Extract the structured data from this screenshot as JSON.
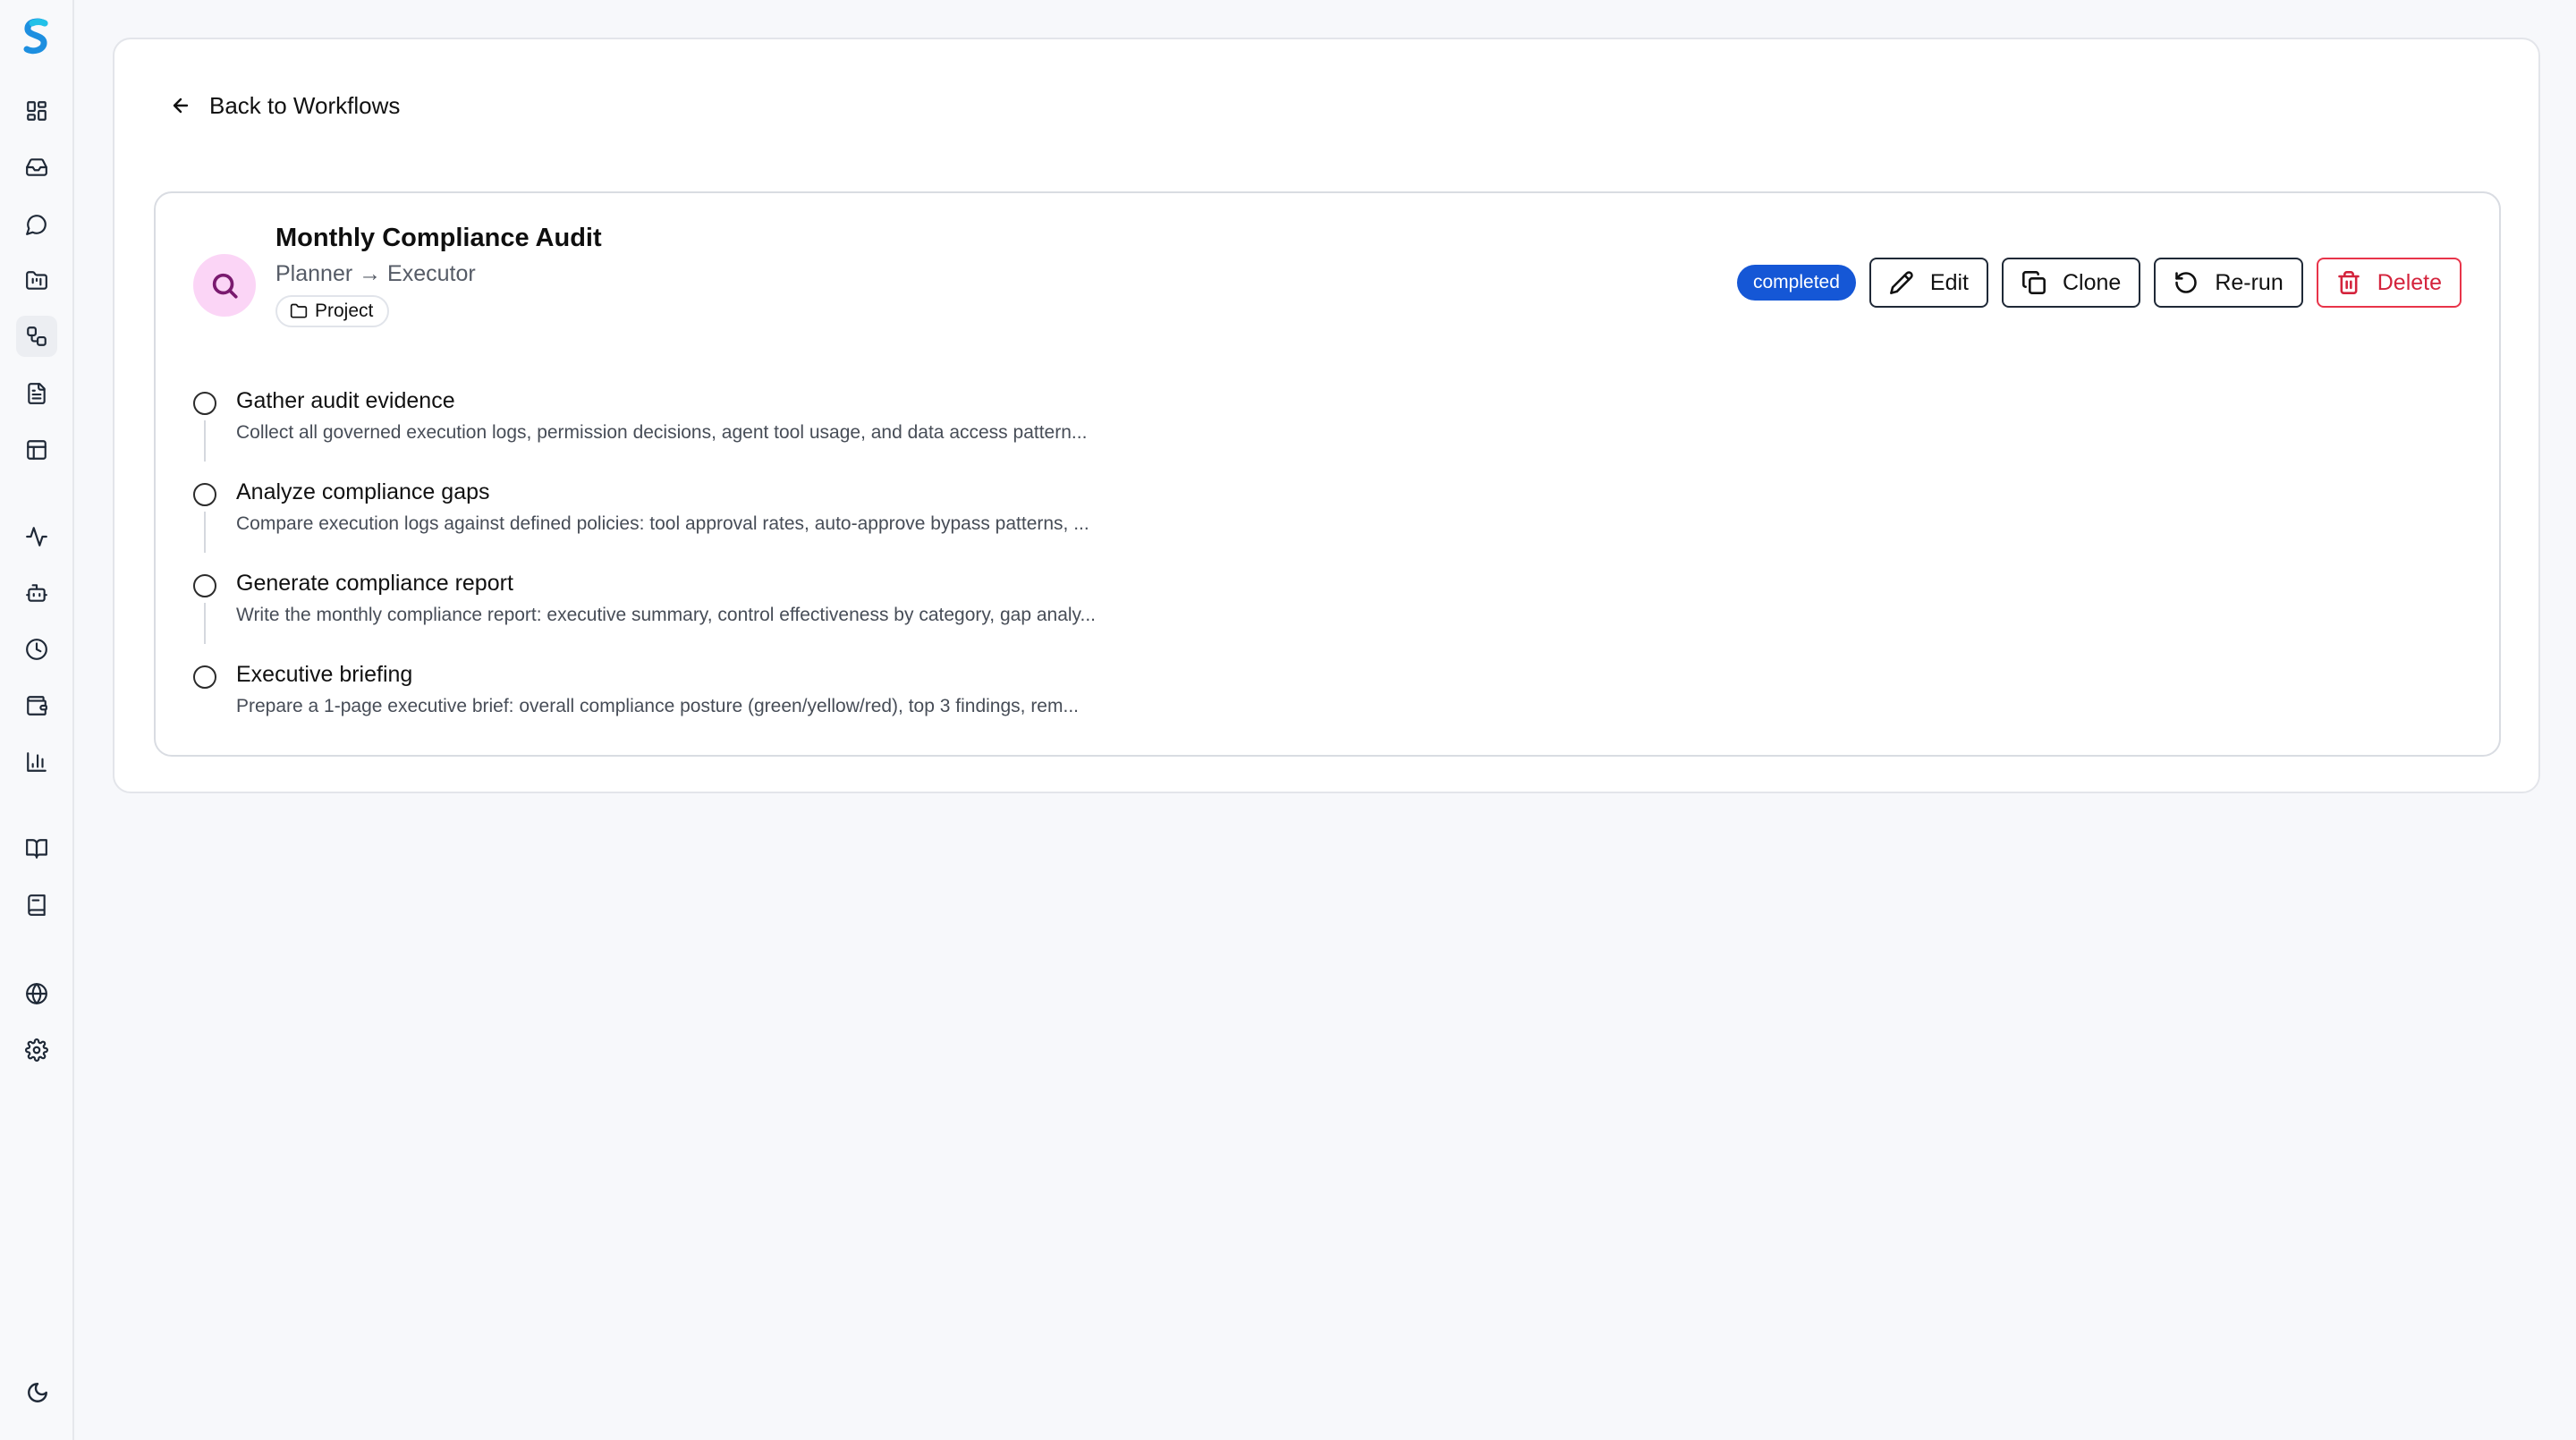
{
  "sidebar": {
    "items": [
      {
        "name": "dashboard-icon"
      },
      {
        "name": "inbox-icon"
      },
      {
        "name": "chat-icon"
      },
      {
        "name": "projects-icon"
      },
      {
        "name": "workflows-icon",
        "active": true
      },
      {
        "name": "document-icon"
      },
      {
        "name": "table-icon"
      },
      {
        "name": "activity-icon"
      },
      {
        "name": "bot-icon"
      },
      {
        "name": "clock-icon"
      },
      {
        "name": "wallet-icon"
      },
      {
        "name": "chart-icon"
      },
      {
        "name": "book-open-icon"
      },
      {
        "name": "notebook-icon"
      },
      {
        "name": "globe-icon"
      },
      {
        "name": "settings-icon"
      }
    ],
    "theme_toggle": "moon-icon"
  },
  "back_link": {
    "label": "Back to Workflows"
  },
  "workflow": {
    "title": "Monthly Compliance Audit",
    "subtitle": "Planner → Executor",
    "tag": "Project",
    "status": "completed",
    "accent_color": "#fbd5f6",
    "status_color": "#1557d6"
  },
  "actions": {
    "edit": "Edit",
    "clone": "Clone",
    "rerun": "Re-run",
    "delete": "Delete",
    "danger_color": "#d4233c"
  },
  "steps": [
    {
      "title": "Gather audit evidence",
      "description": "Collect all governed execution logs, permission decisions, agent tool usage, and data access pattern..."
    },
    {
      "title": "Analyze compliance gaps",
      "description": "Compare execution logs against defined policies: tool approval rates, auto-approve bypass patterns, ..."
    },
    {
      "title": "Generate compliance report",
      "description": "Write the monthly compliance report: executive summary, control effectiveness by category, gap analy..."
    },
    {
      "title": "Executive briefing",
      "description": "Prepare a 1-page executive brief: overall compliance posture (green/yellow/red), top 3 findings, rem..."
    }
  ]
}
